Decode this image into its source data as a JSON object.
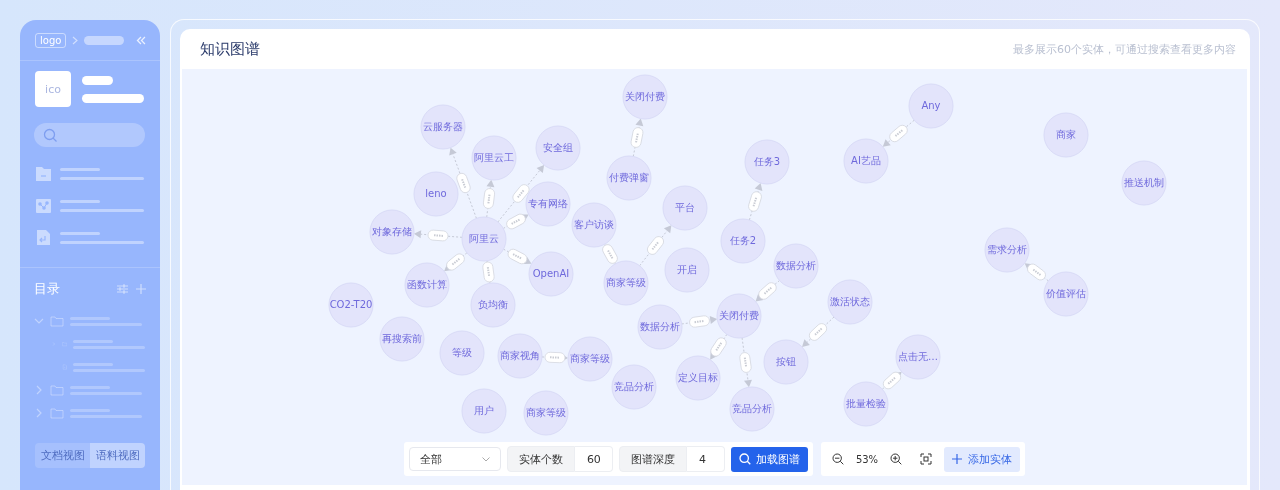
{
  "sidebar": {
    "logo": "logo",
    "avatar": "ico",
    "section_title": "目录",
    "tree": [
      {
        "kind": "folder",
        "expanded": true,
        "children": [
          {
            "kind": "folder",
            "expanded": false
          },
          {
            "kind": "file"
          }
        ]
      },
      {
        "kind": "folder",
        "expanded": false
      },
      {
        "kind": "folder",
        "expanded": false
      }
    ],
    "view_tabs": [
      {
        "label": "文档视图",
        "selected": false
      },
      {
        "label": "语料视图",
        "selected": true
      }
    ]
  },
  "header": {
    "title": "知识图谱",
    "hint": "最多展示60个实体，可通过搜索查看更多内容"
  },
  "graph": {
    "nodes": [
      {
        "label": "关闭付费"
      },
      {
        "label": "Any"
      },
      {
        "label": "云服务器"
      },
      {
        "label": "商家"
      },
      {
        "label": "安全组"
      },
      {
        "label": "阿里云工"
      },
      {
        "label": "任务3"
      },
      {
        "label": "AI艺品"
      },
      {
        "label": "付费弹窗"
      },
      {
        "label": "推送机制"
      },
      {
        "label": "leno"
      },
      {
        "label": "专有网络"
      },
      {
        "label": "平台"
      },
      {
        "label": "对象存储"
      },
      {
        "label": "阿里云"
      },
      {
        "label": "客户访谈"
      },
      {
        "label": "任务2"
      },
      {
        "label": "需求分析"
      },
      {
        "label": "CO2-T20"
      },
      {
        "label": "函数计算"
      },
      {
        "label": "负均衡"
      },
      {
        "label": "OpenAI"
      },
      {
        "label": "商家等级"
      },
      {
        "label": "开启"
      },
      {
        "label": "数据分析"
      },
      {
        "label": "激活状态"
      },
      {
        "label": "价值评估"
      },
      {
        "label": "关闭付费"
      },
      {
        "label": "数据分析"
      },
      {
        "label": "再搜索前"
      },
      {
        "label": "等级"
      },
      {
        "label": "商家视角"
      },
      {
        "label": "商家等级"
      },
      {
        "label": "按钮"
      },
      {
        "label": "点击无…"
      },
      {
        "label": "竞品分析"
      },
      {
        "label": "定义目标"
      },
      {
        "label": "用户"
      },
      {
        "label": "商家等级"
      },
      {
        "label": "竞品分析"
      },
      {
        "label": "批量检验"
      }
    ]
  },
  "toolbar": {
    "filter": "全部",
    "entity_count_label": "实体个数",
    "entity_count": "60",
    "depth_label": "图谱深度",
    "depth": "4",
    "load_button": "加载图谱",
    "zoom": "53%",
    "add_button": "添加实体"
  }
}
